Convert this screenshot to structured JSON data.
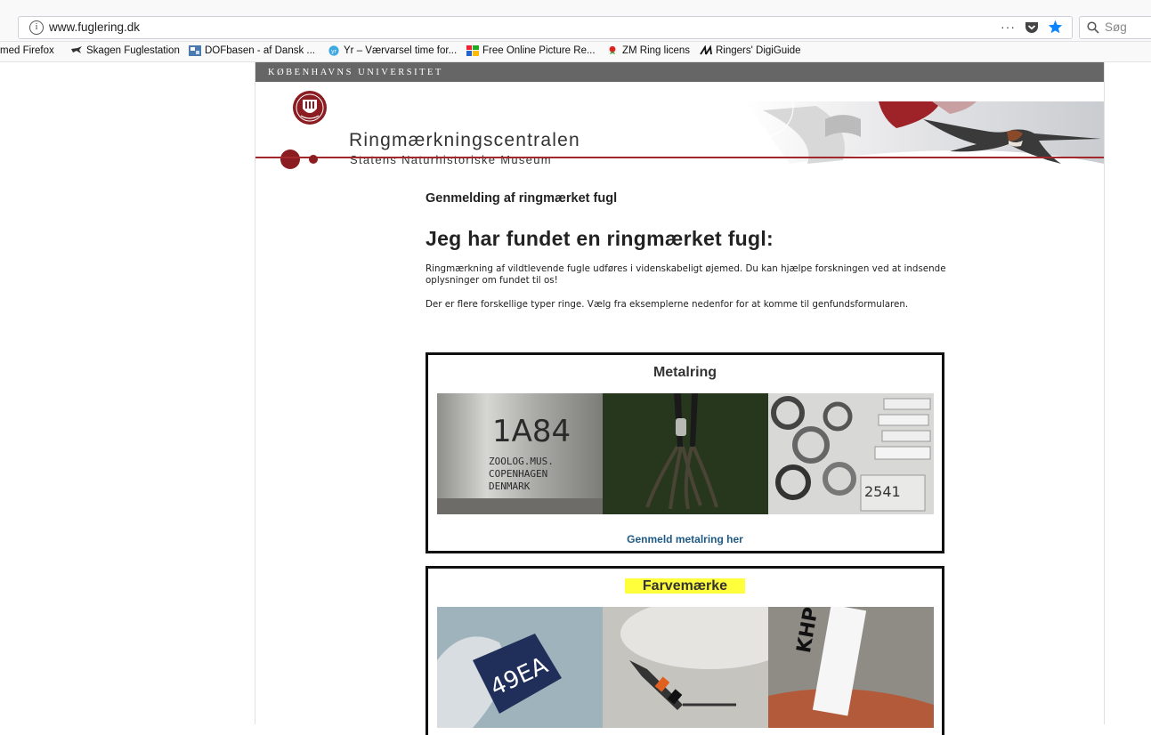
{
  "browser": {
    "url": "www.fuglering.dk",
    "more_label": "···",
    "search_placeholder": "Søg",
    "bookmarks": [
      {
        "label": "med Firefox",
        "icon": "none"
      },
      {
        "label": "Skagen Fuglestation",
        "icon": "bird-icon"
      },
      {
        "label": "DOFbasen - af Dansk ...",
        "icon": "dof-icon"
      },
      {
        "label": "Yr – Værvarsel time for...",
        "icon": "yr-icon"
      },
      {
        "label": "Free Online Picture Re...",
        "icon": "picture-icon"
      },
      {
        "label": "ZM Ring licens",
        "icon": "pin-icon"
      },
      {
        "label": "Ringers' DigiGuide",
        "icon": "digiguide-icon"
      }
    ]
  },
  "site": {
    "university": "KØBENHAVNS UNIVERSITET",
    "title": "Ringmærkningscentralen",
    "subtitle": "Statens Naturhistoriske Museum"
  },
  "main": {
    "kicker": "Genmelding af ringmærket fugl",
    "heading": "Jeg har fundet en ringmærket fugl:",
    "para1": "Ringmærkning af vildtlevende fugle udføres i videnskabeligt øjemed. Du kan hjælpe forskningen ved at indsende oplysninger om fundet til os!",
    "para2": "Der er flere forskellige typer ringe. Vælg fra eksemplerne nedenfor for at komme til genfundsformularen."
  },
  "cards": {
    "metal": {
      "title": "Metalring",
      "link": "Genmeld metalring her",
      "ring_line1": "1A84",
      "ring_line2": "ZOOLOG.MUS.",
      "ring_line3": "COPENHAGEN",
      "ring_line4": "DENMARK",
      "tag_number": "2541"
    },
    "color": {
      "title": "Farvemærke",
      "ring_code": "49EA",
      "flag_code": "KHP"
    }
  },
  "colors": {
    "ku_band": "#666666",
    "brand_red": "#8b1c22",
    "link": "#1f5a86",
    "highlight": "#ffff3b"
  }
}
